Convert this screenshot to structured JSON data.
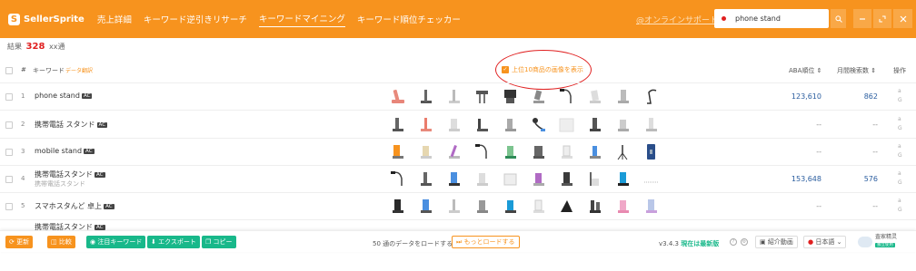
{
  "header": {
    "logo_text": "SellerSprite",
    "logo_letter": "S",
    "nav": [
      "売上詳細",
      "キーワード逆引きリサーチ",
      "キーワードマイニング",
      "キーワード順位チェッカー"
    ],
    "support_link": "@オンラインサポート",
    "search_value": "phone stand",
    "search_icon": "search-icon",
    "buttons": [
      "minimize-icon",
      "expand-icon",
      "close-icon"
    ]
  },
  "result": {
    "label_pre": "結果",
    "count": "328",
    "label_post": "xx通"
  },
  "columns": {
    "index": "#",
    "keyword": "キーワード",
    "keyword_extra": "データ翻訳",
    "show_images": "上位10商品の画像を表示",
    "aba": "ABA順位 ⇕",
    "monthly": "月間検索数 ⇕",
    "ops": "操作"
  },
  "rows": [
    {
      "num": "1",
      "keyword": "phone stand",
      "badge": "AC",
      "sub": "",
      "aba": "123,610",
      "monthly": "862"
    },
    {
      "num": "2",
      "keyword": "携帯電話 スタンド",
      "badge": "AC",
      "sub": "",
      "aba": "--",
      "monthly": "--"
    },
    {
      "num": "3",
      "keyword": "mobile stand",
      "badge": "AC",
      "sub": "",
      "aba": "--",
      "monthly": "--"
    },
    {
      "num": "4",
      "keyword": "携帯電話スタンド",
      "badge": "AC",
      "sub": "携帯電話スタンド",
      "aba": "153,648",
      "monthly": "576"
    },
    {
      "num": "5",
      "keyword": "スマホスタんど 卓上",
      "badge": "AC",
      "sub": "",
      "aba": "--",
      "monthly": "--"
    },
    {
      "num": "6",
      "keyword": "携帯電話スタンド",
      "badge": "AC",
      "sub": "",
      "aba": "",
      "monthly": ""
    }
  ],
  "ops_labels": [
    "a",
    "G"
  ],
  "footer": {
    "buttons": [
      "更新",
      "比較",
      "注目キーワード",
      "エクスポート",
      "コピー"
    ],
    "load_text": "50 通のデータをロードする",
    "load_more": "もっとロードする",
    "version_pre": "v3.4.3",
    "version_post": "現在は最新版",
    "intro_video": "紹介動画",
    "language": "日本語",
    "assistant_line1": "査家精灵",
    "assistant_tag": "独立使用"
  },
  "colors": {
    "brand": "#f7931e",
    "accent_red": "#e02020",
    "link_blue": "#2a5d9f",
    "green": "#18b88a"
  }
}
